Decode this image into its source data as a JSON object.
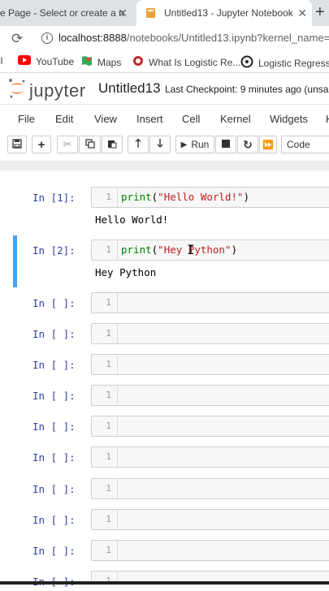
{
  "browser": {
    "tabs": [
      {
        "title": "me Page - Select or create a n",
        "active": false
      },
      {
        "title": "Untitled13 - Jupyter Notebook",
        "active": true
      }
    ],
    "new_tab": "+",
    "url_host": "localhost:8888",
    "url_path": "/notebooks/Untitled13.ipynb?kernel_name=p",
    "bookmarks": [
      {
        "label": "il",
        "icon": "gmail-icon"
      },
      {
        "label": "YouTube",
        "icon": "youtube-icon"
      },
      {
        "label": "Maps",
        "icon": "maps-icon"
      },
      {
        "label": "What Is Logistic Re...",
        "icon": "bookmark-site-icon"
      },
      {
        "label": "Logistic Regressio",
        "icon": "bookmark-site-icon"
      }
    ]
  },
  "jupyter": {
    "logo_text": "jupyter",
    "notebook_name": "Untitled13",
    "checkpoint": "Last Checkpoint: 9 minutes ago  (unsa",
    "menu": [
      "File",
      "Edit",
      "View",
      "Insert",
      "Cell",
      "Kernel",
      "Widgets",
      "H"
    ],
    "toolbar": {
      "run_label": "Run",
      "cell_type": "Code"
    }
  },
  "cells": [
    {
      "prompt": "In [1]:",
      "lineno": "1",
      "code_fn": "print",
      "code_open": "(",
      "code_str": "\"Hello World!\"",
      "code_close": ")",
      "output": "Hello World!"
    },
    {
      "prompt": "In [2]:",
      "lineno": "1",
      "code_fn": "print",
      "code_open": "(",
      "code_str": "\"Hey Python\"",
      "code_close": ")",
      "output": "Hey Python"
    },
    {
      "prompt": "In [ ]:",
      "lineno": "1"
    },
    {
      "prompt": "In [ ]:",
      "lineno": "1"
    },
    {
      "prompt": "In [ ]:",
      "lineno": "1"
    },
    {
      "prompt": "In [ ]:",
      "lineno": "1"
    },
    {
      "prompt": "In [ ]:",
      "lineno": "1"
    },
    {
      "prompt": "In [ ]:",
      "lineno": "1"
    },
    {
      "prompt": "In [ ]:",
      "lineno": "1"
    },
    {
      "prompt": "In [ ]:",
      "lineno": "1"
    },
    {
      "prompt": "In [ ]:",
      "lineno": "1"
    },
    {
      "prompt": "In [ ]:",
      "lineno": "1"
    }
  ],
  "colors": {
    "jupyter_orange": "#f37626",
    "selected_cell_border": "#42a5f5",
    "prompt_blue": "#303f9f"
  }
}
